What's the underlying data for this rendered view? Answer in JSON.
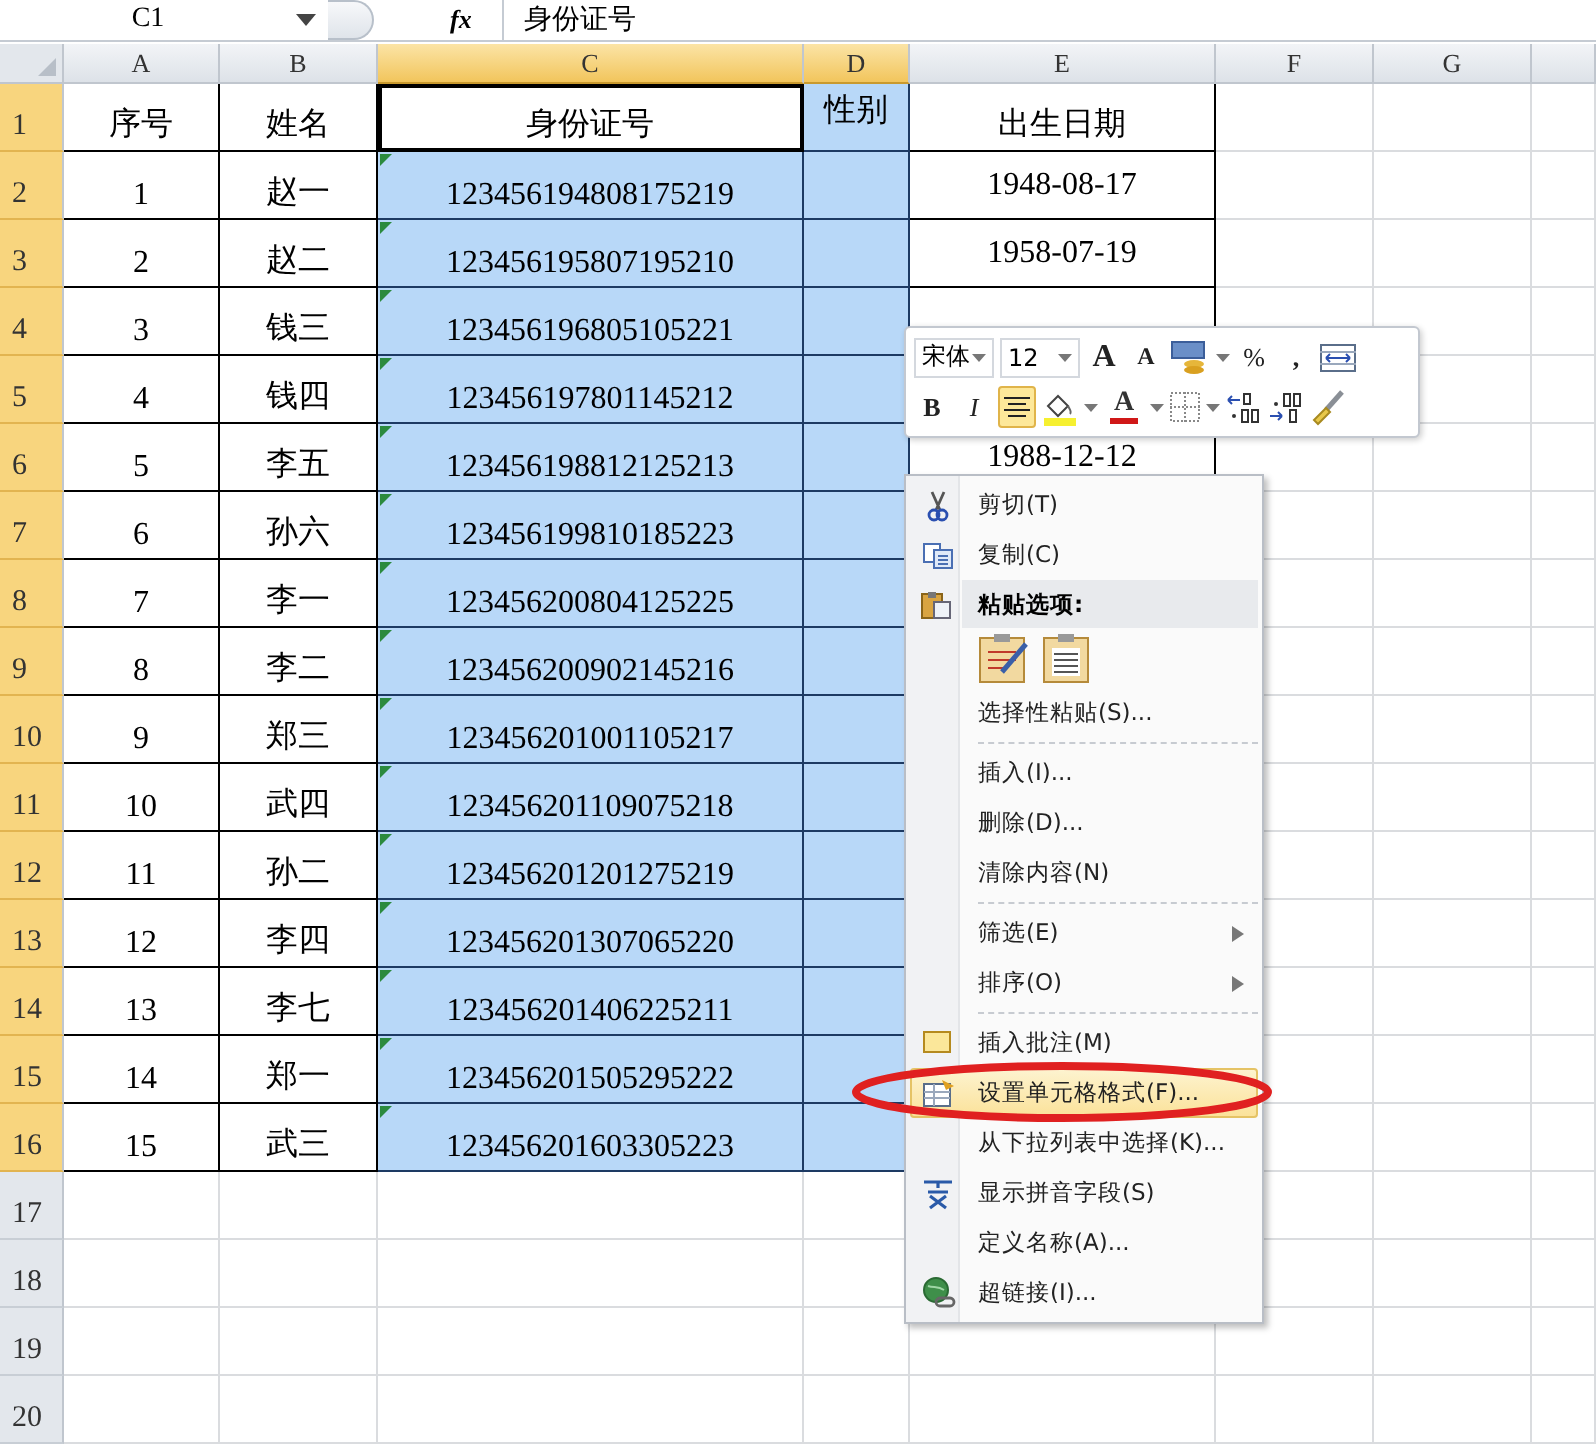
{
  "formula_bar": {
    "name_box": "C1",
    "fx": "fx",
    "formula": "身份证号"
  },
  "columns": [
    {
      "label": "A",
      "selected": false,
      "active": false
    },
    {
      "label": "B",
      "selected": false,
      "active": false
    },
    {
      "label": "C",
      "selected": true,
      "active": true
    },
    {
      "label": "D",
      "selected": true,
      "active": false
    },
    {
      "label": "E",
      "selected": false,
      "active": false
    },
    {
      "label": "F",
      "selected": false,
      "active": false
    },
    {
      "label": "G",
      "selected": false,
      "active": false
    }
  ],
  "rows": [
    {
      "number": "1",
      "selected": true,
      "active": true,
      "id_flag": false,
      "seq": "序号",
      "name": "姓名",
      "id_number": "身份证号",
      "gender": "性别",
      "birth_date": "出生日期"
    },
    {
      "number": "2",
      "selected": true,
      "active": false,
      "id_flag": true,
      "seq": "1",
      "name": "赵一",
      "id_number": "123456194808175219",
      "birth_date": "1948-08-17"
    },
    {
      "number": "3",
      "selected": true,
      "active": false,
      "id_flag": true,
      "seq": "2",
      "name": "赵二",
      "id_number": "123456195807195210",
      "birth_date": "1958-07-19"
    },
    {
      "number": "4",
      "selected": true,
      "active": false,
      "id_flag": true,
      "seq": "3",
      "name": "钱三",
      "id_number": "123456196805105221"
    },
    {
      "number": "5",
      "selected": true,
      "active": false,
      "id_flag": true,
      "seq": "4",
      "name": "钱四",
      "id_number": "123456197801145212"
    },
    {
      "number": "6",
      "selected": true,
      "active": false,
      "id_flag": true,
      "seq": "5",
      "name": "李五",
      "id_number": "123456198812125213",
      "birth_date": "1988-12-12"
    },
    {
      "number": "7",
      "selected": true,
      "active": false,
      "id_flag": true,
      "seq": "6",
      "name": "孙六",
      "id_number": "123456199810185223"
    },
    {
      "number": "8",
      "selected": true,
      "active": false,
      "id_flag": true,
      "seq": "7",
      "name": "李一",
      "id_number": "123456200804125225"
    },
    {
      "number": "9",
      "selected": true,
      "active": false,
      "id_flag": true,
      "seq": "8",
      "name": "李二",
      "id_number": "123456200902145216"
    },
    {
      "number": "10",
      "selected": true,
      "active": false,
      "id_flag": true,
      "seq": "9",
      "name": "郑三",
      "id_number": "123456201001105217"
    },
    {
      "number": "11",
      "selected": true,
      "active": false,
      "id_flag": true,
      "seq": "10",
      "name": "武四",
      "id_number": "123456201109075218"
    },
    {
      "number": "12",
      "selected": true,
      "active": false,
      "id_flag": true,
      "seq": "11",
      "name": "孙二",
      "id_number": "123456201201275219"
    },
    {
      "number": "13",
      "selected": true,
      "active": false,
      "id_flag": true,
      "seq": "12",
      "name": "李四",
      "id_number": "123456201307065220"
    },
    {
      "number": "14",
      "selected": true,
      "active": false,
      "id_flag": true,
      "seq": "13",
      "name": "李七",
      "id_number": "123456201406225211"
    },
    {
      "number": "15",
      "selected": true,
      "active": false,
      "id_flag": true,
      "seq": "14",
      "name": "郑一",
      "id_number": "123456201505295222"
    },
    {
      "number": "16",
      "selected": true,
      "active": false,
      "id_flag": true,
      "seq": "15",
      "name": "武三",
      "id_number": "123456201603305223"
    },
    {
      "number": "17",
      "selected": false,
      "active": false,
      "id_flag": false
    },
    {
      "number": "18",
      "selected": false,
      "active": false,
      "id_flag": false
    },
    {
      "number": "19",
      "selected": false,
      "active": false,
      "id_flag": false
    },
    {
      "number": "20",
      "selected": false,
      "active": false,
      "id_flag": false
    }
  ],
  "mini_toolbar": {
    "rows": [
      [
        {
          "kind": "combo",
          "value": "宋体"
        },
        {
          "kind": "combo",
          "value": "12"
        },
        {
          "kind": "grow_font",
          "label": "A"
        },
        {
          "kind": "shrink_font",
          "label": "A"
        },
        {
          "kind": "accounting"
        },
        {
          "kind": "percent",
          "label": "%"
        },
        {
          "kind": "comma",
          "label": ","
        },
        {
          "kind": "merge"
        }
      ],
      [
        {
          "kind": "bold",
          "label": "B",
          "selected": false
        },
        {
          "kind": "italic",
          "label": "I",
          "selected": false
        },
        {
          "kind": "align_center",
          "selected": true
        },
        {
          "kind": "fill_color"
        },
        {
          "kind": "font_color",
          "label": "A"
        },
        {
          "kind": "borders"
        },
        {
          "kind": "increase_decimal"
        },
        {
          "kind": "decrease_decimal"
        },
        {
          "kind": "format_painter"
        }
      ]
    ]
  },
  "context_menu": [
    {
      "kind": "item",
      "label": "剪切(T)",
      "selected": false
    },
    {
      "kind": "item",
      "label": "复制(C)",
      "selected": false
    },
    {
      "kind": "header",
      "label": "粘贴选项:"
    },
    {
      "kind": "paste_options"
    },
    {
      "kind": "item",
      "label": "选择性粘贴(S)...",
      "selected": false
    },
    {
      "kind": "separator"
    },
    {
      "kind": "item",
      "label": "插入(I)...",
      "selected": false
    },
    {
      "kind": "item",
      "label": "删除(D)...",
      "selected": false
    },
    {
      "kind": "item",
      "label": "清除内容(N)",
      "selected": false
    },
    {
      "kind": "separator"
    },
    {
      "kind": "item",
      "label": "筛选(E)",
      "selected": false,
      "submenu": true
    },
    {
      "kind": "item",
      "label": "排序(O)",
      "selected": false,
      "submenu": true
    },
    {
      "kind": "separator"
    },
    {
      "kind": "item",
      "label": "插入批注(M)",
      "selected": false
    },
    {
      "kind": "item",
      "label": "设置单元格格式(F)...",
      "selected": true
    },
    {
      "kind": "item",
      "label": "从下拉列表中选择(K)...",
      "selected": false
    },
    {
      "kind": "item",
      "label": "显示拼音字段(S)",
      "selected": false
    },
    {
      "kind": "item",
      "label": "定义名称(A)...",
      "selected": false
    },
    {
      "kind": "item",
      "label": "超链接(I)...",
      "selected": false
    }
  ],
  "annotation": {
    "kind": "ellipse"
  }
}
